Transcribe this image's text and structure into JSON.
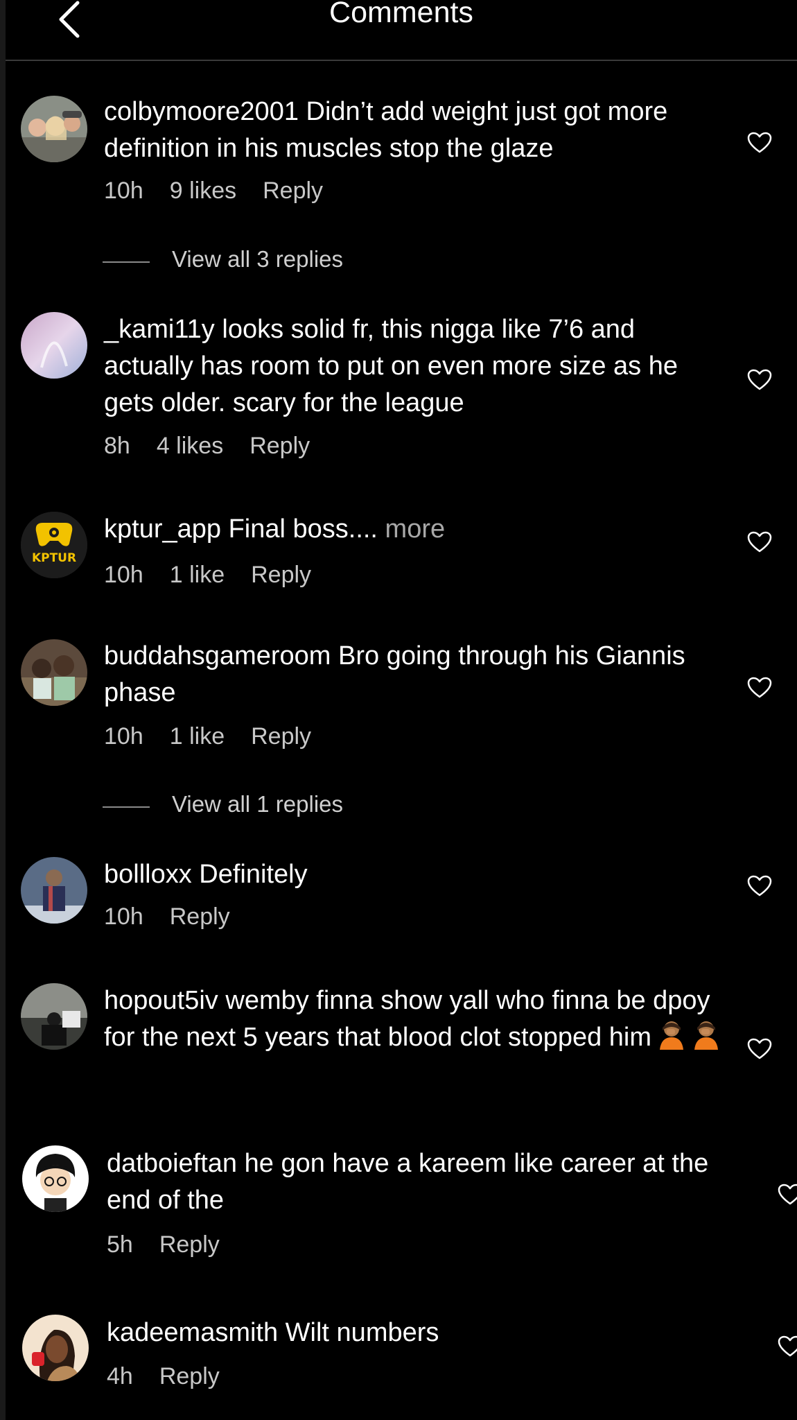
{
  "header": {
    "title": "Comments"
  },
  "comments": [
    {
      "username": "colbymoore2001",
      "text": " Didn’t add weight just got more definition in his muscles stop the glaze",
      "time": "10h",
      "likes": "9 likes",
      "reply": "Reply",
      "replies": "View all 3 replies"
    },
    {
      "username": "_kami11y",
      "text": " looks solid fr, this nigga like 7’6 and actually has room to put on even more size as he gets older. scary for the league",
      "time": "8h",
      "likes": "4 likes",
      "reply": "Reply"
    },
    {
      "username": "kptur_app",
      "text": " Final boss....",
      "more": " more",
      "time": "10h",
      "likes": "1 like",
      "reply": "Reply",
      "avatar_text": "KPTUR"
    },
    {
      "username": "buddahsgameroom",
      "text": " Bro going through his Giannis phase",
      "time": "10h",
      "likes": "1 like",
      "reply": "Reply",
      "replies": "View all 1 replies"
    },
    {
      "username": "bollloxx",
      "text": " Definitely",
      "time": "10h",
      "reply": "Reply"
    },
    {
      "username": "hopout5iv",
      "text": " wemby finna show yall who finna be dpoy for the next 5 years that blood clot stopped him",
      "time": "",
      "reply": ""
    },
    {
      "username": "datboieftan",
      "text": " he gon have a kareem like career at the end of the",
      "time": "5h",
      "reply": "Reply"
    },
    {
      "username": "kadeemasmith",
      "text": " Wilt numbers",
      "time": "4h",
      "reply": "Reply"
    }
  ],
  "colors": {
    "background": "#000000",
    "text": "#ffffff",
    "meta": "#c8c8c8",
    "divider": "#3a3a3a"
  },
  "icons": {
    "back": "chevron-left-icon",
    "like": "heart-outline-icon",
    "emoji": "person-facepalming-icon"
  }
}
